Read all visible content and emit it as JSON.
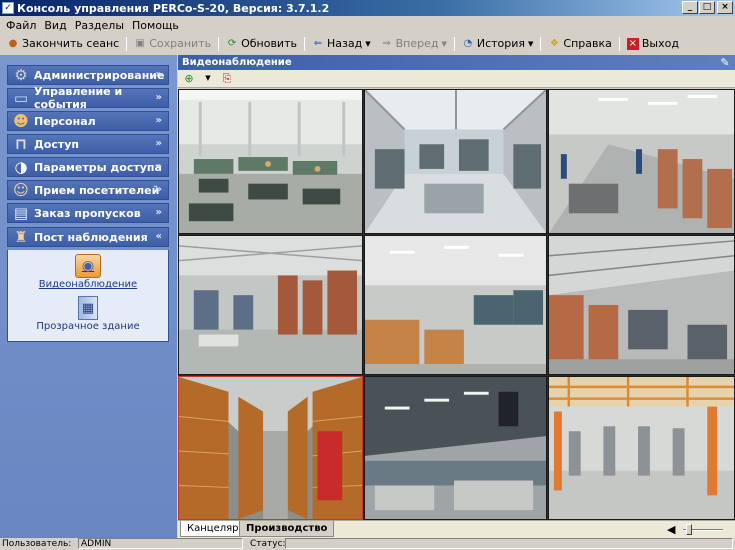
{
  "window": {
    "title": "Консоль управления PERCo-S-20, Версия: 3.7.1.2",
    "buttons": {
      "minimize": "_",
      "maximize": "□",
      "close": "×"
    }
  },
  "menu": [
    "Файл",
    "Вид",
    "Разделы",
    "Помощь"
  ],
  "toolbar": {
    "end_session": "Закончить сеанс",
    "save": "Сохранить",
    "refresh": "Обновить",
    "back": "Назад",
    "forward": "Вперед",
    "history": "История",
    "help": "Справка",
    "exit": "Выход"
  },
  "sidebar": {
    "groups": [
      {
        "label": "Администрирование",
        "icon": "gears-icon"
      },
      {
        "label": "Управление и события",
        "icon": "monitor-icon"
      },
      {
        "label": "Персонал",
        "icon": "people-icon"
      },
      {
        "label": "Доступ",
        "icon": "lock-icon"
      },
      {
        "label": "Параметры доступа",
        "icon": "clock-icon"
      },
      {
        "label": "Прием посетителей",
        "icon": "visitor-icon"
      },
      {
        "label": "Заказ пропусков",
        "icon": "card-icon"
      },
      {
        "label": "Пост наблюдения",
        "icon": "guard-icon"
      }
    ],
    "expanded_items": [
      {
        "label": "Видеонаблюдение",
        "icon": "camera-icon",
        "active": true
      },
      {
        "label": "Прозрачное здание",
        "icon": "building-icon",
        "active": false
      }
    ],
    "chevron_down": "»",
    "chevron_up": "«"
  },
  "main": {
    "title": "Видеонаблюдение",
    "tabs": [
      "Канцелярия",
      "Производство"
    ],
    "active_tab": "Канцелярия",
    "volume_level": 0.1
  },
  "statusbar": {
    "user_label": "Пользователь:",
    "user_value": "ADMIN",
    "status_label": "Статус:",
    "status_value": ""
  }
}
